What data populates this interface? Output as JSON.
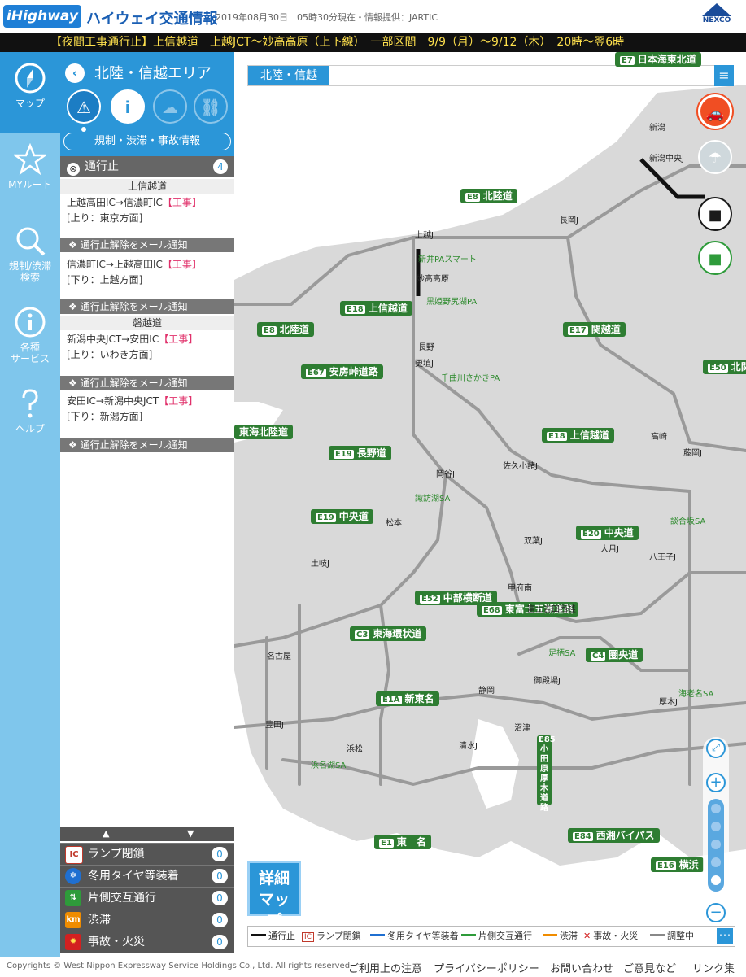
{
  "header": {
    "logo_text": "iHighway",
    "app_title": "ハイウェイ交通情報",
    "timestamp": "2019年08月30日　05時30分現在・情報提供：JARTIC",
    "nexco_text": "NEXCO"
  },
  "ticker": {
    "text": "【夜間工事通行止】上信越道　上越JCT～妙高高原（上下線）　一部区間　9/9（月）～9/12（木）　20時～翌6時"
  },
  "leftnav": {
    "items": [
      {
        "label": "マップ",
        "icon": "compass-icon",
        "active": true
      },
      {
        "label": "MYルート",
        "icon": "star-icon"
      },
      {
        "label": "規制/渋滞\n検索",
        "icon": "search-icon"
      },
      {
        "label": "各種\nサービス",
        "icon": "info-icon"
      },
      {
        "label": "ヘルプ",
        "icon": "question-icon"
      }
    ]
  },
  "panel": {
    "area_title": "北陸・信越エリア",
    "category_label": "規制・渋滞・事故情報",
    "closed_title": "通行止",
    "closed_count": "4",
    "roads": [
      {
        "name": "上信越道"
      },
      {
        "name": "磐越道"
      }
    ],
    "entries": [
      {
        "route": "上越高田IC→信濃町IC",
        "tag": "【工事】",
        "dir": "[上り：東京方面]"
      },
      {
        "route": "信濃町IC→上越高田IC",
        "tag": "【工事】",
        "dir": "[下り：上越方面]"
      },
      {
        "route": "新潟中央JCT→安田IC",
        "tag": "【工事】",
        "dir": "[上り：いわき方面]"
      },
      {
        "route": "安田IC→新潟中央JCT",
        "tag": "【工事】",
        "dir": "[下り：新潟方面]"
      }
    ],
    "mail_notify": "通行止解除をメール通知",
    "scroll_up": "▲",
    "scroll_down": "▼",
    "legend": [
      {
        "icon": "IC",
        "label": "ランプ閉鎖",
        "count": "0",
        "color": "#ffffff",
        "text_color": "#c0392b"
      },
      {
        "icon": "❄",
        "label": "冬用タイヤ等装着",
        "count": "0",
        "color": "#1f6fd1",
        "text_color": "#ffffff"
      },
      {
        "icon": "⇅",
        "label": "片側交互通行",
        "count": "0",
        "color": "#2e9b3a",
        "text_color": "#ffffff"
      },
      {
        "icon": "km",
        "label": "渋滞",
        "count": "0",
        "color": "#f08c00",
        "text_color": "#ffffff"
      },
      {
        "icon": "✹",
        "label": "事故・火災",
        "count": "0",
        "color": "#d32020",
        "text_color": "#ffe14d"
      }
    ]
  },
  "map": {
    "search_label": "北陸・信越",
    "detail_map_label": "詳細マップ",
    "road_labels": [
      {
        "code": "E7",
        "name": "日本海東北道"
      },
      {
        "code": "E8",
        "name": "北陸道"
      },
      {
        "code": "E18",
        "name": "上信越道"
      },
      {
        "code": "E8",
        "name": "北陸道"
      },
      {
        "code": "E17",
        "name": "関越道"
      },
      {
        "code": "E67",
        "name": "安房峠道路"
      },
      {
        "code": "E50",
        "name": "北関"
      },
      {
        "code": "",
        "name": "東海北陸道"
      },
      {
        "code": "E19",
        "name": "長野道"
      },
      {
        "code": "E18",
        "name": "上信越道"
      },
      {
        "code": "E19",
        "name": "中央道"
      },
      {
        "code": "E20",
        "name": "中央道"
      },
      {
        "code": "E52",
        "name": "中部横断道"
      },
      {
        "code": "C3",
        "name": "東海環状道"
      },
      {
        "code": "E68",
        "name": "東富士五湖道路"
      },
      {
        "code": "C4",
        "name": "圏央道"
      },
      {
        "code": "E1A",
        "name": "新東名"
      },
      {
        "code": "E85",
        "name": "小田原厚木道路"
      },
      {
        "code": "E1",
        "name": "東　名"
      },
      {
        "code": "E84",
        "name": "西湘バイパス"
      },
      {
        "code": "E16",
        "name": "横浜"
      }
    ],
    "place_labels": [
      {
        "text": "上越J",
        "green": false
      },
      {
        "text": "長岡J",
        "green": false
      },
      {
        "text": "新潟中央J",
        "green": false
      },
      {
        "text": "更埴J",
        "green": false
      },
      {
        "text": "佐久小諸J",
        "green": false
      },
      {
        "text": "岡谷J",
        "green": false
      },
      {
        "text": "双葉J",
        "green": false
      },
      {
        "text": "大月J",
        "green": false
      },
      {
        "text": "八王子J",
        "green": false
      },
      {
        "text": "豊田J",
        "green": false
      },
      {
        "text": "土岐J",
        "green": false
      },
      {
        "text": "御殿場J",
        "green": false
      },
      {
        "text": "清水J",
        "green": false
      },
      {
        "text": "厚木J",
        "green": false
      },
      {
        "text": "妙高高原",
        "green": false
      },
      {
        "text": "新井PAスマート",
        "green": true
      },
      {
        "text": "黒姫野尻湖PA",
        "green": true
      },
      {
        "text": "千曲川さかきPA",
        "green": true
      },
      {
        "text": "諏訪湖SA",
        "green": true
      },
      {
        "text": "談合坂SA",
        "green": true
      },
      {
        "text": "足柄SA",
        "green": true
      },
      {
        "text": "海老名SA",
        "green": true
      },
      {
        "text": "浜名湖SA",
        "green": true
      },
      {
        "text": "新潟",
        "green": false
      },
      {
        "text": "長野",
        "green": false
      },
      {
        "text": "松本",
        "green": false
      },
      {
        "text": "甲府南",
        "green": false
      },
      {
        "text": "富士吉田西桂",
        "green": false
      },
      {
        "text": "浜松",
        "green": false
      },
      {
        "text": "静岡",
        "green": false
      },
      {
        "text": "沼津",
        "green": false
      },
      {
        "text": "名古屋",
        "green": false
      },
      {
        "text": "高崎",
        "green": false
      },
      {
        "text": "藤岡J",
        "green": false
      }
    ],
    "legend": [
      {
        "label": "通行止",
        "color": "#111111"
      },
      {
        "label": "ランプ閉鎖",
        "color": "#c0392b"
      },
      {
        "label": "冬用タイヤ等装着",
        "color": "#1f6fd1"
      },
      {
        "label": "片側交互通行",
        "color": "#2e9b3a"
      },
      {
        "label": "渋滞",
        "color": "#f08c00"
      },
      {
        "label": "事故・火災",
        "color": "#d32020"
      },
      {
        "label": "調整中",
        "color": "#888888"
      }
    ],
    "legend_more": "･･･"
  },
  "footer": {
    "copyright": "Copyrights © West Nippon Expressway Service Holdings Co., Ltd. All rights reserved.",
    "links": [
      "ご利用上の注意",
      "プライバシーポリシー",
      "お問い合わせ",
      "ご意見など",
      "リンク集"
    ]
  }
}
